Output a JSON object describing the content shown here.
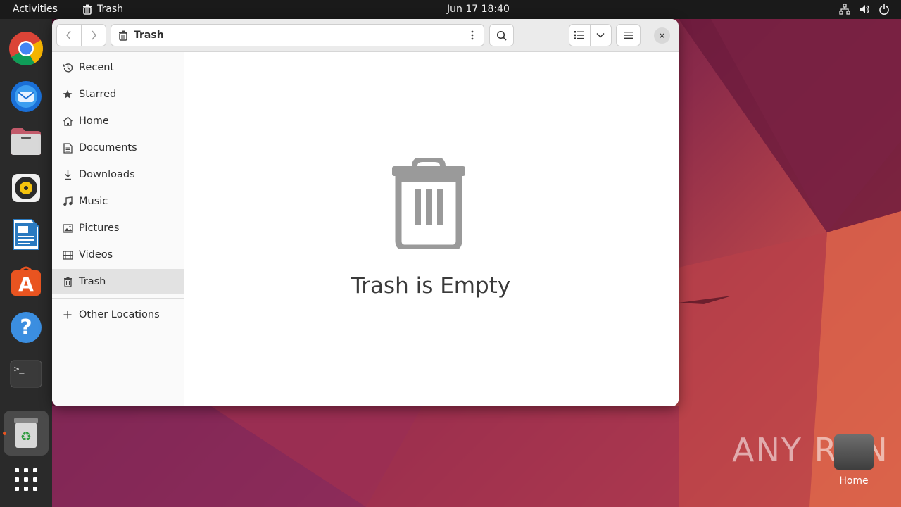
{
  "topbar": {
    "activities": "Activities",
    "app_name": "Trash",
    "clock": "Jun 17  18:40",
    "tray_icons": [
      "network-icon",
      "volume-icon",
      "power-icon"
    ]
  },
  "dock": {
    "apps": [
      "chrome",
      "thunderbird",
      "files",
      "rhythmbox",
      "libreoffice-writer",
      "app-center",
      "help",
      "terminal",
      "trash",
      "show-apps"
    ]
  },
  "window": {
    "path_label": "Trash",
    "close_symbol": "✕"
  },
  "sidebar": {
    "items": [
      {
        "label": "Recent",
        "icon": "clock-icon"
      },
      {
        "label": "Starred",
        "icon": "star-icon"
      },
      {
        "label": "Home",
        "icon": "home-icon"
      },
      {
        "label": "Documents",
        "icon": "document-icon"
      },
      {
        "label": "Downloads",
        "icon": "download-icon"
      },
      {
        "label": "Music",
        "icon": "music-icon"
      },
      {
        "label": "Pictures",
        "icon": "picture-icon"
      },
      {
        "label": "Videos",
        "icon": "video-icon"
      },
      {
        "label": "Trash",
        "icon": "trash-icon",
        "selected": true
      }
    ],
    "other_locations": "Other Locations"
  },
  "content": {
    "empty_title": "Trash is Empty"
  },
  "desktop": {
    "home_label": "Home",
    "watermark": "ANY RUN"
  },
  "colors": {
    "accent": "#e95420",
    "selected_bg": "#e2e2e2"
  }
}
